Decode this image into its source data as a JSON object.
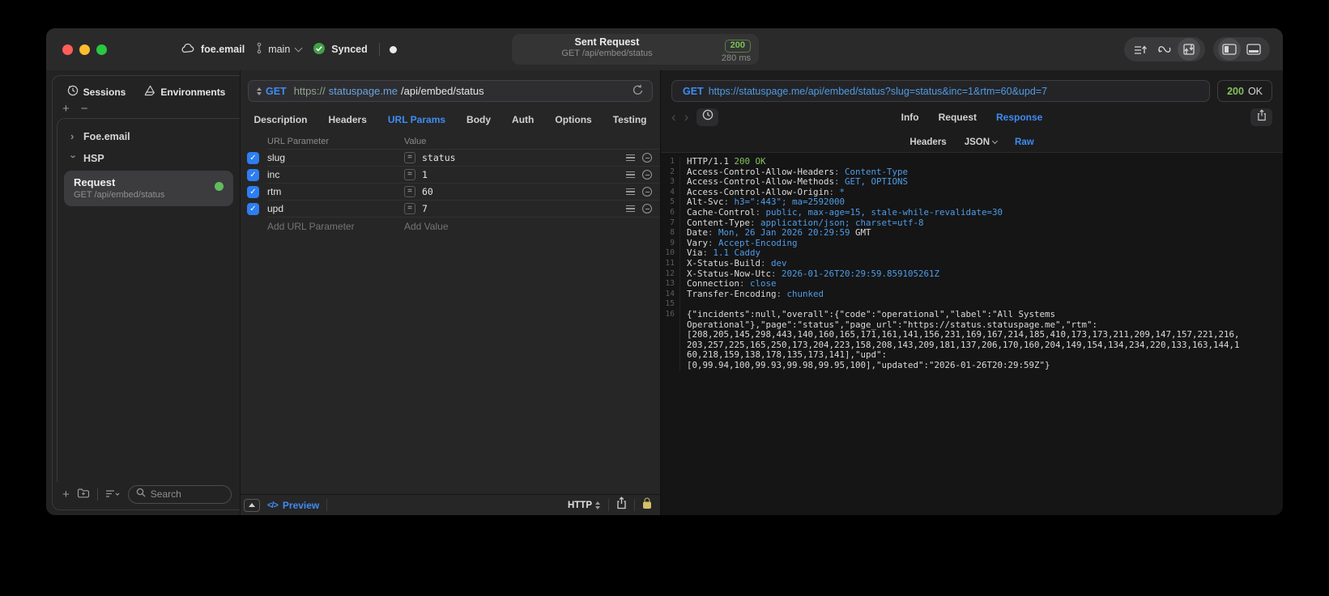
{
  "titlebar": {
    "project": "foe.email",
    "branch": "main",
    "sync_status": "Synced",
    "request_summary": {
      "title": "Sent Request",
      "subtitle": "GET /api/embed/status",
      "status_code": "200",
      "duration": "280 ms"
    }
  },
  "sidebar": {
    "tabs": [
      {
        "label": "Sessions"
      },
      {
        "label": "Environments"
      }
    ],
    "tree": [
      {
        "label": "Foe.email"
      },
      {
        "label": "HSP"
      }
    ],
    "request_item": {
      "title": "Request",
      "subtitle": "GET /api/embed/status"
    },
    "search": {
      "placeholder": "Search"
    }
  },
  "request_pane": {
    "method": "GET",
    "url": {
      "scheme": "https://",
      "host": "statuspage.me",
      "path": "/api/embed/status"
    },
    "tabs": [
      "Description",
      "Headers",
      "URL Params",
      "Body",
      "Auth",
      "Options",
      "Testing"
    ],
    "active_tab": "URL Params",
    "params": {
      "columns": [
        "URL Parameter",
        "Value"
      ],
      "operator": "=",
      "rows": [
        {
          "checked": true,
          "name": "slug",
          "value": "status"
        },
        {
          "checked": true,
          "name": "inc",
          "value": "1"
        },
        {
          "checked": true,
          "name": "rtm",
          "value": "60"
        },
        {
          "checked": true,
          "name": "upd",
          "value": "7"
        }
      ],
      "add_name": "Add URL Parameter",
      "add_value": "Add Value"
    },
    "footer": {
      "preview": "Preview",
      "protocol": "HTTP"
    }
  },
  "response_pane": {
    "method": "GET",
    "url": "https://statuspage.me/api/embed/status?slug=status&inc=1&rtm=60&upd=7",
    "status_code": "200",
    "status_text": "OK",
    "tabs": [
      "Info",
      "Request",
      "Response"
    ],
    "active_tab": "Response",
    "subtabs": [
      "Headers",
      "JSON",
      "Raw"
    ],
    "active_subtab": "Raw",
    "raw_lines": [
      {
        "n": "1",
        "segs": [
          [
            "HTTP/1.1 ",
            "w"
          ],
          [
            "200 OK",
            "g"
          ]
        ]
      },
      {
        "n": "2",
        "segs": [
          [
            "Access-Control-Allow-Headers",
            "w"
          ],
          [
            ": ",
            "d"
          ],
          [
            "Content-Type",
            "b"
          ]
        ]
      },
      {
        "n": "3",
        "segs": [
          [
            "Access-Control-Allow-Methods",
            "w"
          ],
          [
            ": ",
            "d"
          ],
          [
            "GET, OPTIONS",
            "b"
          ]
        ]
      },
      {
        "n": "4",
        "segs": [
          [
            "Access-Control-Allow-Origin",
            "w"
          ],
          [
            ": ",
            "d"
          ],
          [
            "*",
            "b"
          ]
        ]
      },
      {
        "n": "5",
        "segs": [
          [
            "Alt-Svc",
            "w"
          ],
          [
            ": ",
            "d"
          ],
          [
            "h3=\":443\"; ma=2592000",
            "b"
          ]
        ]
      },
      {
        "n": "6",
        "segs": [
          [
            "Cache-Control",
            "w"
          ],
          [
            ": ",
            "d"
          ],
          [
            "public, max-age=15, stale-while-revalidate=30",
            "b"
          ]
        ]
      },
      {
        "n": "7",
        "segs": [
          [
            "Content-Type",
            "w"
          ],
          [
            ": ",
            "d"
          ],
          [
            "application/json; charset=utf-8",
            "b"
          ]
        ]
      },
      {
        "n": "8",
        "segs": [
          [
            "Date",
            "w"
          ],
          [
            ": ",
            "d"
          ],
          [
            "Mon, 26 Jan 2026 20:29:59 ",
            "b"
          ],
          [
            "GMT",
            "w"
          ]
        ]
      },
      {
        "n": "9",
        "segs": [
          [
            "Vary",
            "w"
          ],
          [
            ": ",
            "d"
          ],
          [
            "Accept-Encoding",
            "b"
          ]
        ]
      },
      {
        "n": "10",
        "segs": [
          [
            "Via",
            "w"
          ],
          [
            ": ",
            "d"
          ],
          [
            "1.1 Caddy",
            "b"
          ]
        ]
      },
      {
        "n": "11",
        "segs": [
          [
            "X-Status-Build",
            "w"
          ],
          [
            ": ",
            "d"
          ],
          [
            "dev",
            "b"
          ]
        ]
      },
      {
        "n": "12",
        "segs": [
          [
            "X-Status-Now-Utc",
            "w"
          ],
          [
            ": ",
            "d"
          ],
          [
            "2026-01-26T20:29:59.859105261Z",
            "b"
          ]
        ]
      },
      {
        "n": "13",
        "segs": [
          [
            "Connection",
            "w"
          ],
          [
            ": ",
            "d"
          ],
          [
            "close",
            "b"
          ]
        ]
      },
      {
        "n": "14",
        "segs": [
          [
            "Transfer-Encoding",
            "w"
          ],
          [
            ": ",
            "d"
          ],
          [
            "chunked",
            "b"
          ]
        ]
      },
      {
        "n": "15",
        "segs": []
      },
      {
        "n": "16",
        "segs": [
          [
            "{\"incidents\":null,\"overall\":{\"code\":\"operational\",\"label\":\"All Systems",
            "w"
          ]
        ]
      },
      {
        "n": "",
        "segs": [
          [
            "Operational\"},\"page\":\"status\",\"page_url\":\"https://status.statuspage.me\",\"rtm\":",
            "w"
          ]
        ]
      },
      {
        "n": "",
        "segs": [
          [
            "[208,205,145,298,443,140,160,165,171,161,141,156,231,169,167,214,185,410,173,173,211,209,147,157,221,216,",
            "w"
          ]
        ]
      },
      {
        "n": "",
        "segs": [
          [
            "203,257,225,165,250,173,204,223,158,208,143,209,181,137,206,170,160,204,149,154,134,234,220,133,163,144,1",
            "w"
          ]
        ]
      },
      {
        "n": "",
        "segs": [
          [
            "60,218,159,138,178,135,173,141],\"upd\":",
            "w"
          ]
        ]
      },
      {
        "n": "",
        "segs": [
          [
            "[0,99.94,100,99.93,99.98,99.95,100],\"updated\":\"2026-01-26T20:29:59Z\"}",
            "w"
          ]
        ]
      }
    ]
  },
  "colors": {
    "accent_blue": "#3f8cf3",
    "code_blue": "#4f9ce6",
    "code_green": "#83c25a",
    "status_green": "#84bf5a",
    "checkbox_blue": "#2e7ef0",
    "dot_green": "#63bb5d"
  }
}
